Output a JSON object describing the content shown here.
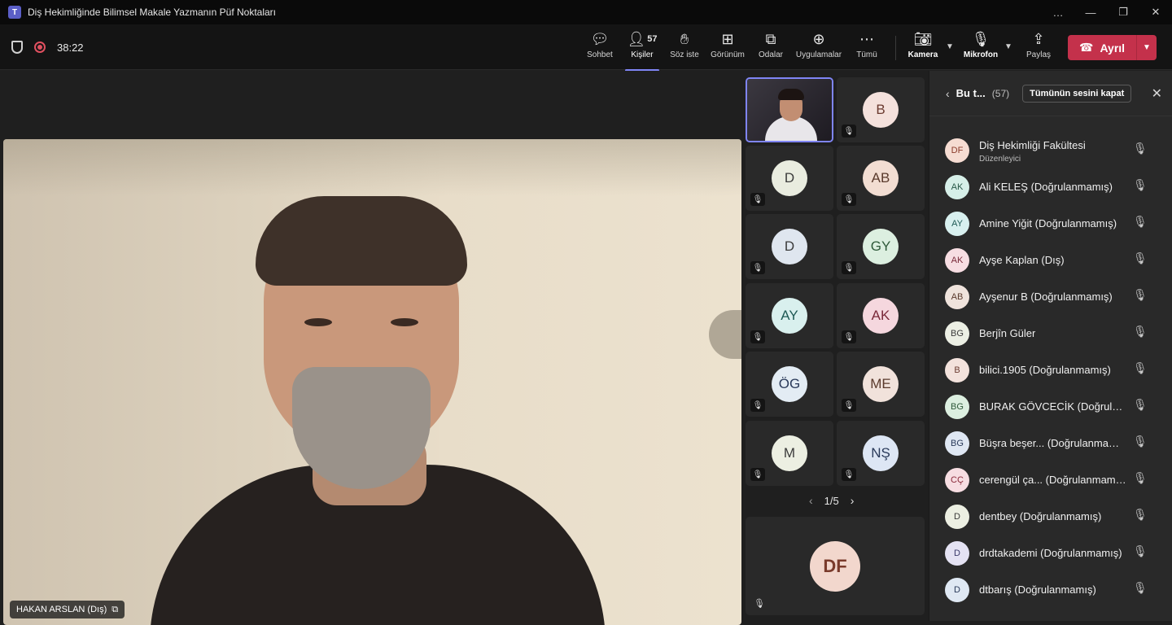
{
  "window": {
    "title": "Diş Hekimliğinde Bilimsel Makale Yazmanın Püf Noktaları",
    "controls": [
      "…",
      "—",
      "❐",
      "✕"
    ]
  },
  "toolbar": {
    "timer": "38:22",
    "buttons": {
      "chat": "Sohbet",
      "people": "Kişiler",
      "people_count": "57",
      "raise": "Söz iste",
      "view": "Görünüm",
      "rooms": "Odalar",
      "apps": "Uygulamalar",
      "more": "Tümü",
      "camera": "Kamera",
      "mic": "Mikrofon",
      "share": "Paylaş"
    },
    "leave_label": "Ayrıl"
  },
  "main_video": {
    "name": "HAKAN ARSLAN (Dış)"
  },
  "grid": {
    "tiles": [
      {
        "initials": "B",
        "bg": "#f4e1dc",
        "fg": "#6b3b30"
      },
      {
        "initials": "D",
        "bg": "#e9ecdf",
        "fg": "#3b3b3b"
      },
      {
        "initials": "AB",
        "bg": "#f2ddd2",
        "fg": "#5a3a2c"
      },
      {
        "initials": "D",
        "bg": "#dfe6ef",
        "fg": "#3b3b3b"
      },
      {
        "initials": "GY",
        "bg": "#dcefe0",
        "fg": "#2f5a3a"
      },
      {
        "initials": "AY",
        "bg": "#d9f0ee",
        "fg": "#1f5a55"
      },
      {
        "initials": "AK",
        "bg": "#f5d7de",
        "fg": "#7a2a3a"
      },
      {
        "initials": "ÖG",
        "bg": "#e3ecf4",
        "fg": "#2a3a5a"
      },
      {
        "initials": "ME",
        "bg": "#f1e2db",
        "fg": "#5a3a2c"
      },
      {
        "initials": "M",
        "bg": "#ecefe2",
        "fg": "#3b3b3b"
      },
      {
        "initials": "NŞ",
        "bg": "#dde6f4",
        "fg": "#2a3a5a"
      }
    ],
    "pager": "1/5",
    "bottom_tile": {
      "initials": "DF"
    }
  },
  "panel": {
    "title": "Bu t...",
    "count": "(57)",
    "mute_all": "Tümünün sesini kapat",
    "participants": [
      {
        "initials": "DF",
        "name": "Diş Hekimliği Fakültesi",
        "role": "Düzenleyici",
        "bg": "#f6dcd2",
        "fg": "#8a3a2a"
      },
      {
        "initials": "AK",
        "name": "Ali KELEŞ (Doğrulanmamış)",
        "bg": "#d6efe8",
        "fg": "#2a5a4a"
      },
      {
        "initials": "AY",
        "name": "Amine Yiğit (Doğrulanmamış)",
        "bg": "#d8f0ef",
        "fg": "#1f5a55"
      },
      {
        "initials": "AK",
        "name": "Ayşe Kaplan (Dış)",
        "bg": "#f7dde2",
        "fg": "#7a2a3a"
      },
      {
        "initials": "AB",
        "name": "Ayşenur B (Doğrulanmamış)",
        "bg": "#efe3dc",
        "fg": "#5a3a2c"
      },
      {
        "initials": "BG",
        "name": "Berjîn Güler",
        "bg": "#ecefe4",
        "fg": "#3b3b3b"
      },
      {
        "initials": "B",
        "name": "bilici.1905 (Doğrulanmamış)",
        "bg": "#f3e2dc",
        "fg": "#6b3b30"
      },
      {
        "initials": "BG",
        "name": "BURAK GÖVCECİK (Doğrulan...",
        "bg": "#dcefe0",
        "fg": "#2f5a3a"
      },
      {
        "initials": "BG",
        "name": "Büşra beşer... (Doğrulanmamış)",
        "bg": "#dfe7f3",
        "fg": "#2a3a5a"
      },
      {
        "initials": "CÇ",
        "name": "cerengül ça... (Doğrulanmamış)",
        "bg": "#f7dde2",
        "fg": "#8a2a3a"
      },
      {
        "initials": "D",
        "name": "dentbey (Doğrulanmamış)",
        "bg": "#ecefe2",
        "fg": "#3b3b3b"
      },
      {
        "initials": "D",
        "name": "drdtakademi (Doğrulanmamış)",
        "bg": "#e4e2f3",
        "fg": "#3a3a6a"
      },
      {
        "initials": "D",
        "name": "dtbarış (Doğrulanmamış)",
        "bg": "#dfe8f3",
        "fg": "#2a3a5a"
      }
    ]
  }
}
